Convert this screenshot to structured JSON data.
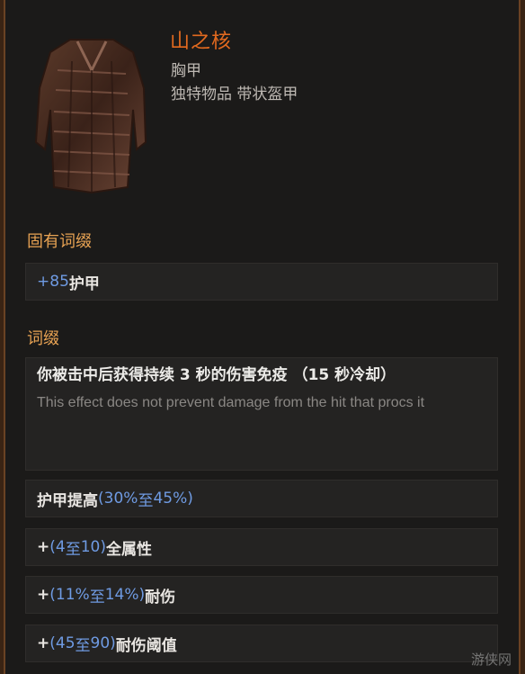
{
  "item": {
    "name": "山之核",
    "slot": "胸甲",
    "rarity_type": "独特物品 带状盔甲"
  },
  "implicit": {
    "title": "固有词缀",
    "lines": [
      {
        "plus": "+",
        "value": "85",
        "text": " 护甲"
      }
    ]
  },
  "affixes": {
    "title": "词缀",
    "special": {
      "text": "你被击中后获得持续 3 秒的伤害免疫 （15 秒冷却）",
      "note": "This effect does not prevent damage from the hit that procs it"
    },
    "lines": [
      {
        "prefix": "护甲提高",
        "open": "(",
        "min": "30%",
        "sep": " 至 ",
        "max": "45%",
        "close": ")",
        "suffix": ""
      },
      {
        "prefix": "+",
        "open": "(",
        "min": "4",
        "sep": " 至 ",
        "max": "10",
        "close": ")",
        "suffix": " 全属性"
      },
      {
        "prefix": "+",
        "open": "(",
        "min": "11%",
        "sep": " 至 ",
        "max": "14%",
        "close": ")",
        "suffix": " 耐伤"
      },
      {
        "prefix": "+",
        "open": "(",
        "min": "45",
        "sep": " 至 ",
        "max": "90",
        "close": ")",
        "suffix": " 耐伤阈值"
      }
    ]
  },
  "watermark": "游侠网",
  "colors": {
    "name": "#e36a1f",
    "section": "#e7a253",
    "number": "#6f9be3",
    "background": "#1b1a19"
  }
}
